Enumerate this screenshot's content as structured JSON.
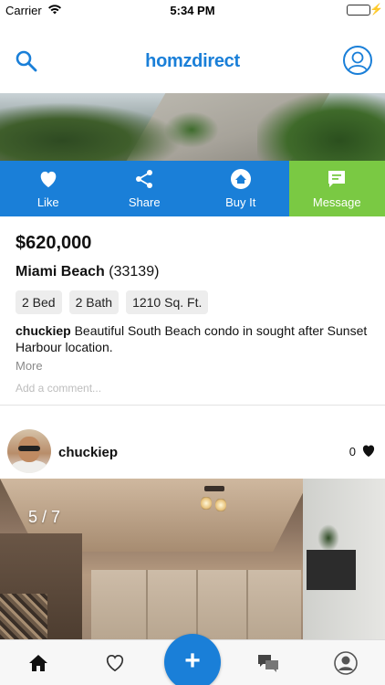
{
  "status_bar": {
    "carrier": "Carrier",
    "time": "5:34 PM",
    "battery_level": 1.0,
    "battery_color": "#4cd964"
  },
  "header": {
    "logo": "homzdirect",
    "search_icon": "search-icon",
    "profile_icon": "profile-icon",
    "accent_color": "#1a7fd8"
  },
  "actions": {
    "like_label": "Like",
    "share_label": "Share",
    "buy_label": "Buy It",
    "message_label": "Message",
    "primary_color": "#1a7fd8",
    "message_color": "#7ac943"
  },
  "listing": {
    "price": "$620,000",
    "city": "Miami Beach",
    "zip": "(33139)",
    "beds": "2 Bed",
    "baths": "2 Bath",
    "sqft": "1210 Sq. Ft.",
    "author": "chuckiep",
    "description": "Beautiful South Beach condo in sought after Sunset Harbour location.",
    "more_label": "More",
    "comment_placeholder": "Add a comment..."
  },
  "post": {
    "username": "chuckiep",
    "like_count": "0",
    "photo_counter": "5 / 7"
  },
  "tab_bar": {
    "tabs": [
      "home-icon",
      "heart-icon",
      "add-icon",
      "chat-icon",
      "profile-icon"
    ],
    "fab_label": "+"
  }
}
